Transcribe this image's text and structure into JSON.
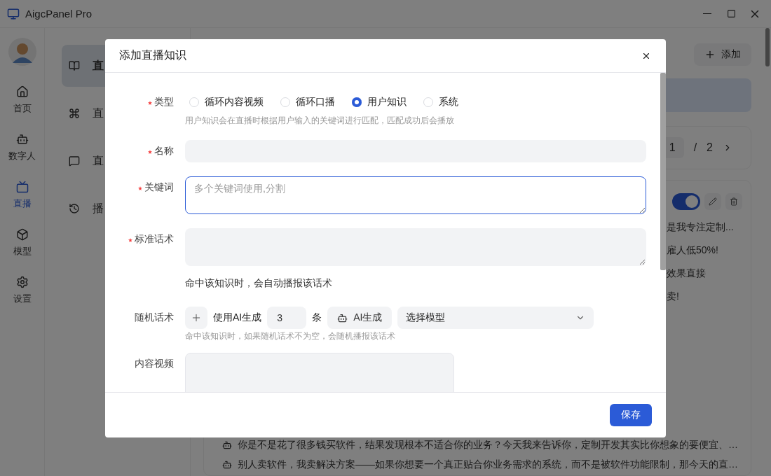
{
  "window": {
    "title": "AigcPanel Pro"
  },
  "nav": {
    "items": [
      {
        "label": "首页",
        "selected": false
      },
      {
        "label": "数字人",
        "selected": false
      },
      {
        "label": "直播",
        "selected": true
      },
      {
        "label": "模型",
        "selected": false
      },
      {
        "label": "设置",
        "selected": false
      }
    ]
  },
  "submenu": {
    "items": [
      {
        "label": "直",
        "selected": true
      },
      {
        "label": "直",
        "selected": false
      },
      {
        "label": "直",
        "selected": false
      },
      {
        "label": "播",
        "selected": false
      }
    ]
  },
  "main": {
    "add_button": "添加",
    "pager": {
      "current": "1",
      "separator": "/",
      "total": "2"
    },
    "card": {
      "enabled": true,
      "partial_lines": [
        "是我专注定制...",
        "雇人低50%!",
        "效果直接",
        "卖!"
      ],
      "lines": [
        "你是不是花了很多钱买软件，结果发现根本不适合你的业务？今天我来告诉你，定制开发其实比你想象的要便宜、…",
        "别人卖软件，我卖解决方案——如果你想要一个真正贴合你业务需求的系统，而不是被软件功能限制，那今天的直…"
      ]
    }
  },
  "dialog": {
    "title": "添加直播知识",
    "fields": [
      {
        "kind": "radio",
        "label": "类型",
        "required": true,
        "options": [
          {
            "label": "循环内容视频",
            "selected": false
          },
          {
            "label": "循环口播",
            "selected": false
          },
          {
            "label": "用户知识",
            "selected": true
          },
          {
            "label": "系统",
            "selected": false
          }
        ],
        "hint": "用户知识会在直播时根据用户输入的关键词进行匹配，匹配成功后会播放"
      },
      {
        "kind": "input",
        "label": "名称",
        "required": true
      },
      {
        "kind": "textarea",
        "label": "关键词",
        "required": true,
        "focused": true,
        "placeholder": "多个关键词使用,分割"
      },
      {
        "kind": "textarea",
        "label": "标准话术",
        "required": true,
        "focused": false,
        "help": "命中该知识时，会自动播报该话术"
      },
      {
        "kind": "random",
        "label": "随机话术",
        "required": false,
        "use_ai": "使用AI生成",
        "count": "3",
        "unit": "条",
        "ai_button": "AI生成",
        "model_placeholder": "选择模型",
        "hint": "命中该知识时，如果随机话术不为空，会随机播报该话术"
      },
      {
        "kind": "video",
        "label": "内容视频",
        "required": false
      }
    ],
    "save_button": "保存"
  }
}
